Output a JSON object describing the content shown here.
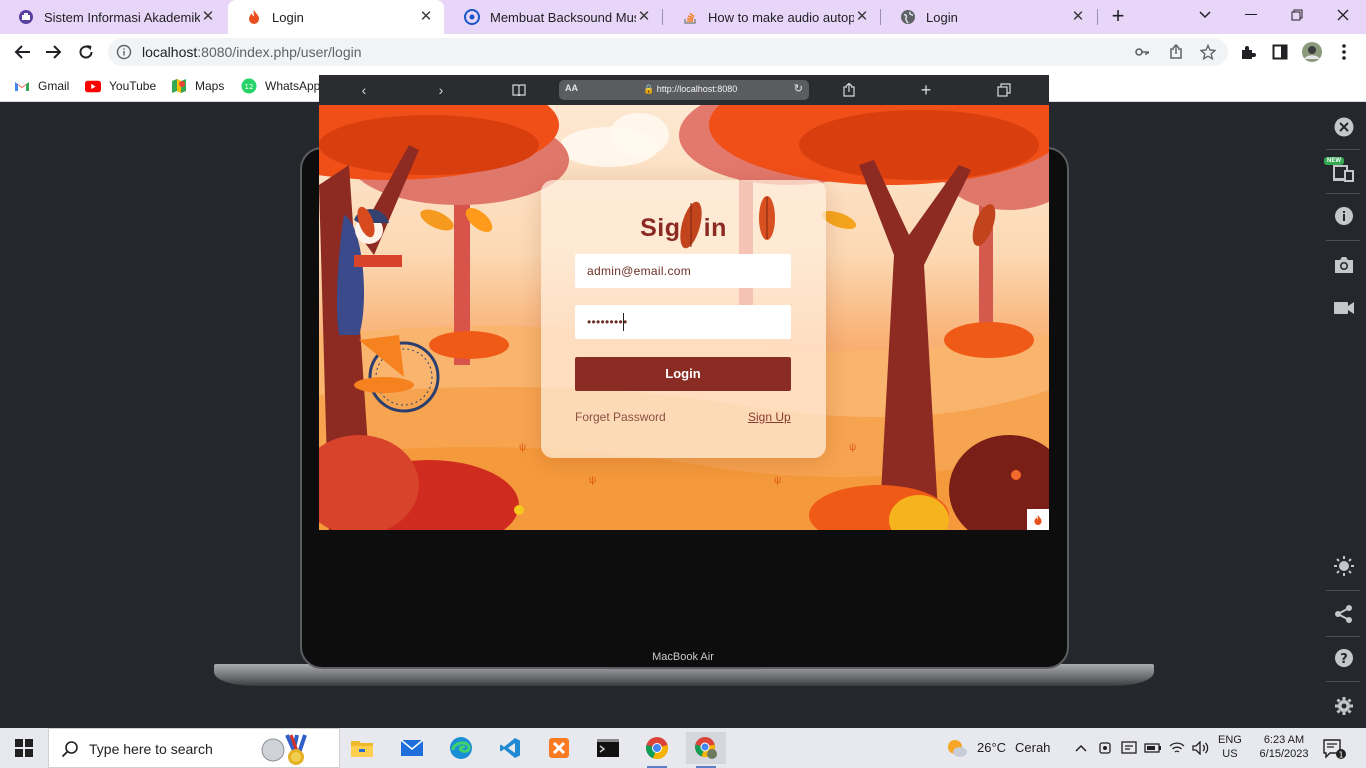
{
  "browser": {
    "tabs": [
      {
        "title": "Sistem Informasi Akademik",
        "icon": "academic-icon",
        "active": false
      },
      {
        "title": "Login",
        "icon": "fire-icon",
        "active": true
      },
      {
        "title": "Membuat Backsound Musik D",
        "icon": "web-icon",
        "active": false
      },
      {
        "title": "How to make audio autoplay",
        "icon": "stackoverflow-icon",
        "active": false
      },
      {
        "title": "Login",
        "icon": "globe-icon",
        "active": false
      }
    ],
    "url_host": "localhost",
    "url_rest": ":8080/index.php/user/login",
    "bookmarks": [
      {
        "label": "Gmail",
        "icon": "gmail-icon"
      },
      {
        "label": "YouTube",
        "icon": "youtube-icon"
      },
      {
        "label": "Maps",
        "icon": "maps-icon"
      },
      {
        "label": "WhatsApp",
        "icon": "whatsapp-icon"
      }
    ]
  },
  "device": {
    "label": "MacBook Air",
    "safari_aa": "AA",
    "safari_url": "http://localhost:8080"
  },
  "login": {
    "title": "Sign in",
    "email_value": "admin@email.com",
    "password_mask": "•••••••••",
    "button_label": "Login",
    "forget_label": "Forget Password",
    "signup_label": "Sign Up"
  },
  "devtools": {
    "new_badge": "NEW"
  },
  "taskbar": {
    "search_placeholder": "Type here to search",
    "weather_temp": "26°C",
    "weather_desc": "Cerah",
    "lang_top": "ENG",
    "lang_bottom": "US",
    "time": "6:23 AM",
    "date": "6/15/2023",
    "notification_count": "1",
    "whatsapp_badge": "12"
  },
  "colors": {
    "tab_strip": "#e8d6f8",
    "login_button": "#8a2c24",
    "title": "#8b2a22",
    "viewport_bg": "#24272b"
  }
}
